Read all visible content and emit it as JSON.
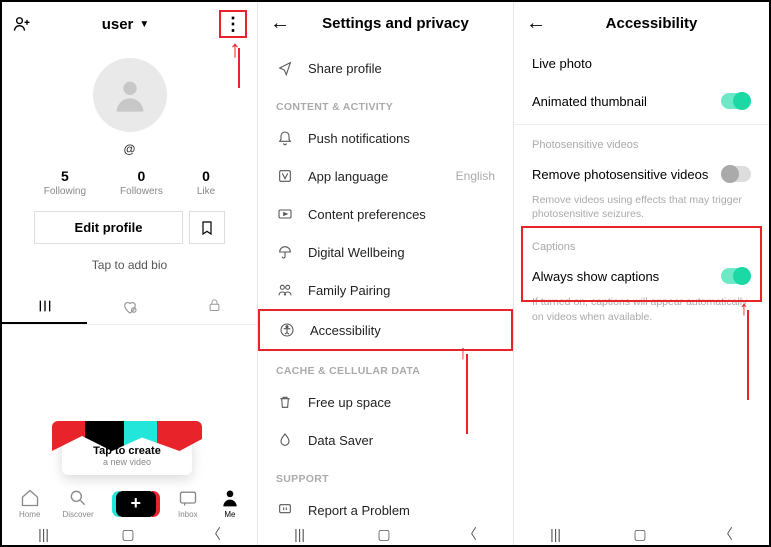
{
  "panel1": {
    "username": "user",
    "handle": "@",
    "stats": [
      {
        "num": "5",
        "lbl": "Following"
      },
      {
        "num": "0",
        "lbl": "Followers"
      },
      {
        "num": "0",
        "lbl": "Like"
      }
    ],
    "edit_label": "Edit profile",
    "bio_placeholder": "Tap to add bio",
    "tap_card_title": "Tap to create",
    "tap_card_sub": "a new video",
    "nav": [
      "Home",
      "Discover",
      "",
      "Inbox",
      "Me"
    ]
  },
  "panel2": {
    "title": "Settings and privacy",
    "rows_top": [
      {
        "icon": "share",
        "label": "Share profile"
      }
    ],
    "section_content": "CONTENT & ACTIVITY",
    "rows_content": [
      {
        "icon": "bell",
        "label": "Push notifications"
      },
      {
        "icon": "lang",
        "label": "App language",
        "right": "English"
      },
      {
        "icon": "pref",
        "label": "Content preferences"
      },
      {
        "icon": "umbrella",
        "label": "Digital Wellbeing"
      },
      {
        "icon": "family",
        "label": "Family Pairing"
      },
      {
        "icon": "access",
        "label": "Accessibility",
        "highlight": true
      }
    ],
    "section_cache": "CACHE & CELLULAR DATA",
    "rows_cache": [
      {
        "icon": "trash",
        "label": "Free up space"
      },
      {
        "icon": "drop",
        "label": "Data Saver"
      }
    ],
    "section_support": "SUPPORT",
    "rows_support": [
      {
        "icon": "flag",
        "label": "Report a Problem"
      }
    ]
  },
  "panel3": {
    "title": "Accessibility",
    "items_top": [
      {
        "label": "Live photo"
      },
      {
        "label": "Animated thumbnail",
        "toggle": "on"
      }
    ],
    "sec_photo": "Photosensitive videos",
    "photo_label": "Remove photosensitive videos",
    "photo_sub": "Remove videos using effects that may trigger photosensitive seizures.",
    "sec_captions": "Captions",
    "captions_label": "Always show captions",
    "captions_sub": "If turned on, captions will appear automatically on videos when available."
  }
}
